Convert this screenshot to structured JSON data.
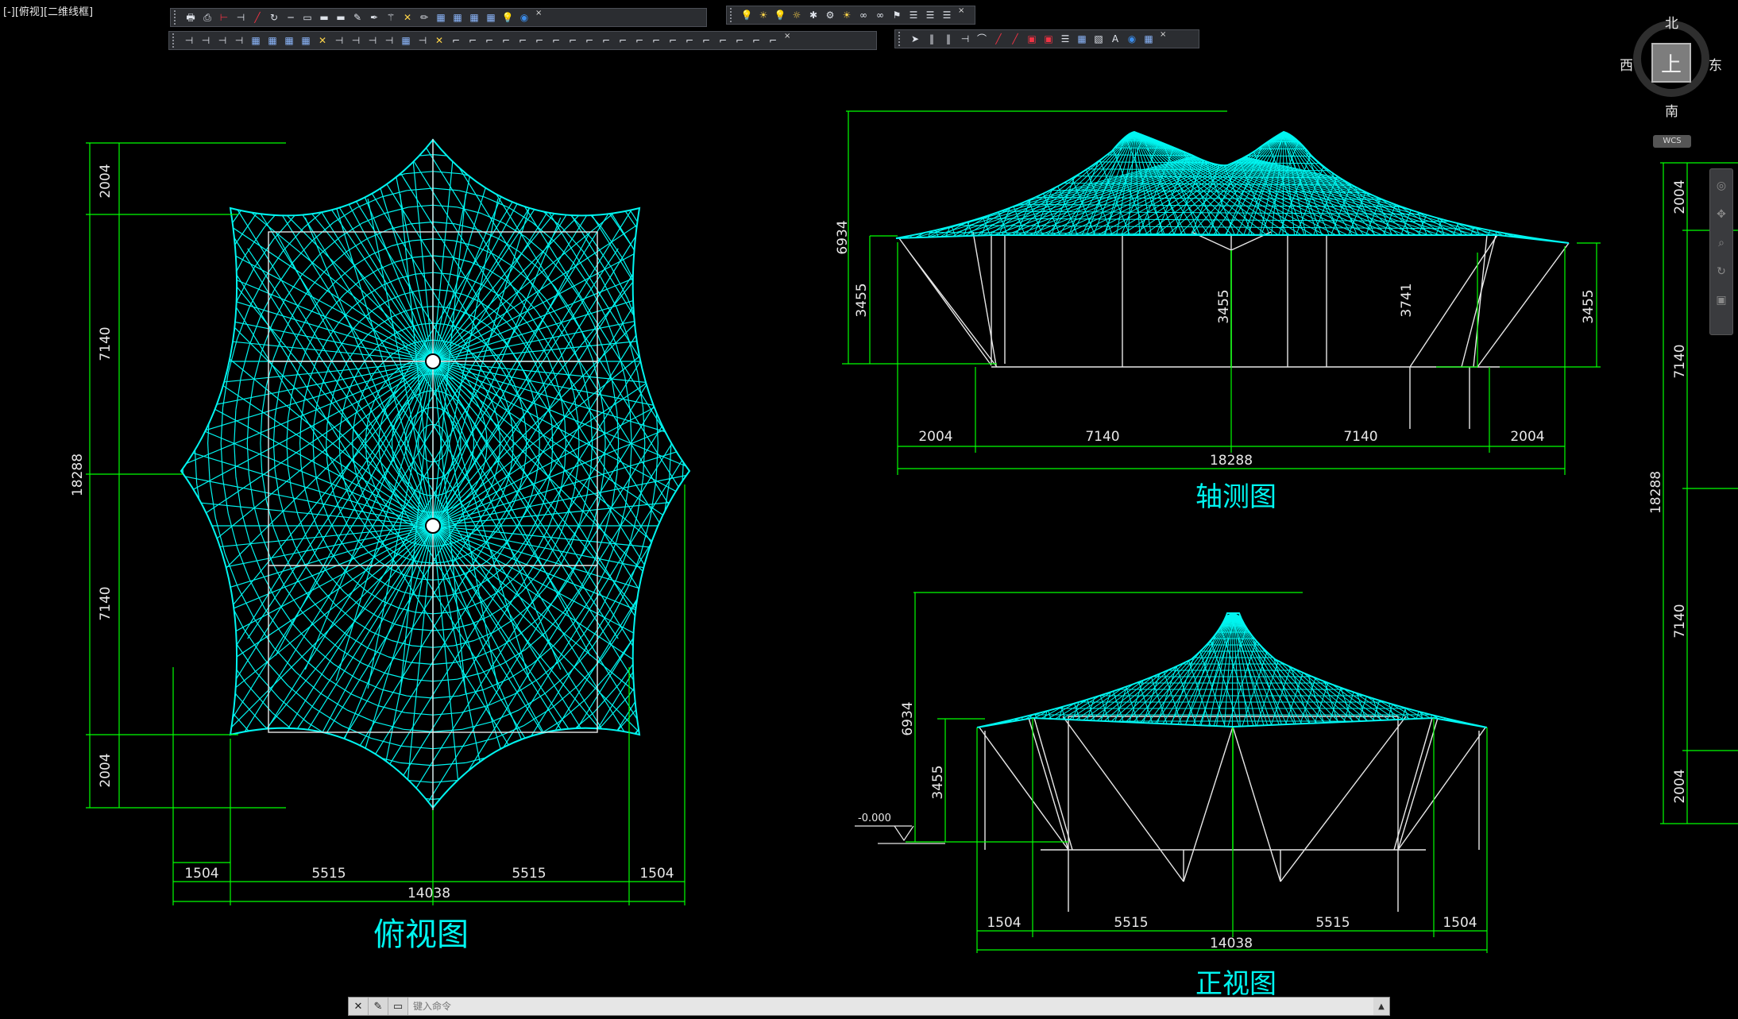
{
  "viewport": {
    "label": "[-][俯视][二维线框]"
  },
  "colors": {
    "background": "#000000",
    "dimension": "#00ff00",
    "mesh": "#00f5f0",
    "structure": "#e8e8e8",
    "title": "#00f5f0"
  },
  "toolbars": [
    {
      "name": "toolbar-1",
      "icons": [
        "plot-icon",
        "print-preview-icon",
        "red-dim-icon",
        "dim-icon",
        "red-line-icon",
        "rotate-icon",
        "line-icon",
        "box-icon",
        "rect-icon",
        "rect-icon",
        "brush-icon",
        "pen-icon",
        "wand-icon",
        "cross-icon",
        "pencil-icon",
        "grid-icon",
        "grid-icon",
        "grid-icon",
        "grid-icon",
        "bulb-icon",
        "globe-icon"
      ]
    },
    {
      "name": "toolbar-2",
      "icons": [
        "bulb-icon",
        "sun-icon",
        "bulb-icon",
        "lamp-icon",
        "star-icon",
        "gear-icon",
        "sun-icon",
        "link-icon",
        "link-icon",
        "flag-icon",
        "layer-icon",
        "layer-icon",
        "layer-icon"
      ]
    },
    {
      "name": "toolbar-3",
      "icons": [
        "dim-icon",
        "dim-icon",
        "dim-icon",
        "dim-icon",
        "grid-icon",
        "grid-icon",
        "grid-icon",
        "grid-icon",
        "cross-icon",
        "dim-icon",
        "dim-icon",
        "dim-icon",
        "dim-icon",
        "grid-icon",
        "dim-icon",
        "cross-icon",
        "snap-icon",
        "snap-icon",
        "snap-icon",
        "snap-icon",
        "snap-icon",
        "snap-icon",
        "snap-icon",
        "snap-icon",
        "snap-icon",
        "snap-icon",
        "snap-icon",
        "snap-icon",
        "snap-icon",
        "snap-icon",
        "snap-icon",
        "snap-icon",
        "snap-icon",
        "snap-icon",
        "snap-icon",
        "snap-icon"
      ]
    },
    {
      "name": "toolbar-4",
      "icons": [
        "pointer-icon",
        "pipe-icon",
        "pipe-icon",
        "dim-icon",
        "arc-icon",
        "red-line-icon",
        "red-line-icon",
        "red-box-icon",
        "red-box-icon",
        "layer-icon",
        "grid-icon",
        "hatch-icon",
        "text-icon",
        "globe-icon",
        "grid-icon"
      ]
    }
  ],
  "view_cube": {
    "north": "北",
    "south": "南",
    "east": "东",
    "west": "西",
    "face": "上",
    "wcs": "WCS"
  },
  "command_line": {
    "placeholder": "键入命令"
  },
  "drawings": {
    "plan": {
      "title": "俯视图",
      "dims_left": [
        "2004",
        "7140",
        "18288",
        "7140",
        "2004"
      ],
      "dims_bottom": [
        "1504",
        "5515",
        "5515",
        "1504"
      ],
      "total_width": "14038"
    },
    "axonometric": {
      "title": "轴测图",
      "dims_vertical": [
        "6934",
        "3455",
        "3455",
        "3741",
        "3455"
      ],
      "dims_bottom": [
        "2004",
        "7140",
        "7140",
        "2004"
      ],
      "total_width": "18288"
    },
    "front": {
      "title": "正视图",
      "dims_vertical": [
        "6934",
        "3455"
      ],
      "level": "-0.000",
      "dims_bottom": [
        "1504",
        "5515",
        "5515",
        "1504"
      ],
      "total_width": "14038"
    },
    "right_dims": [
      "2004",
      "7140",
      "18288",
      "7140",
      "2004"
    ]
  }
}
